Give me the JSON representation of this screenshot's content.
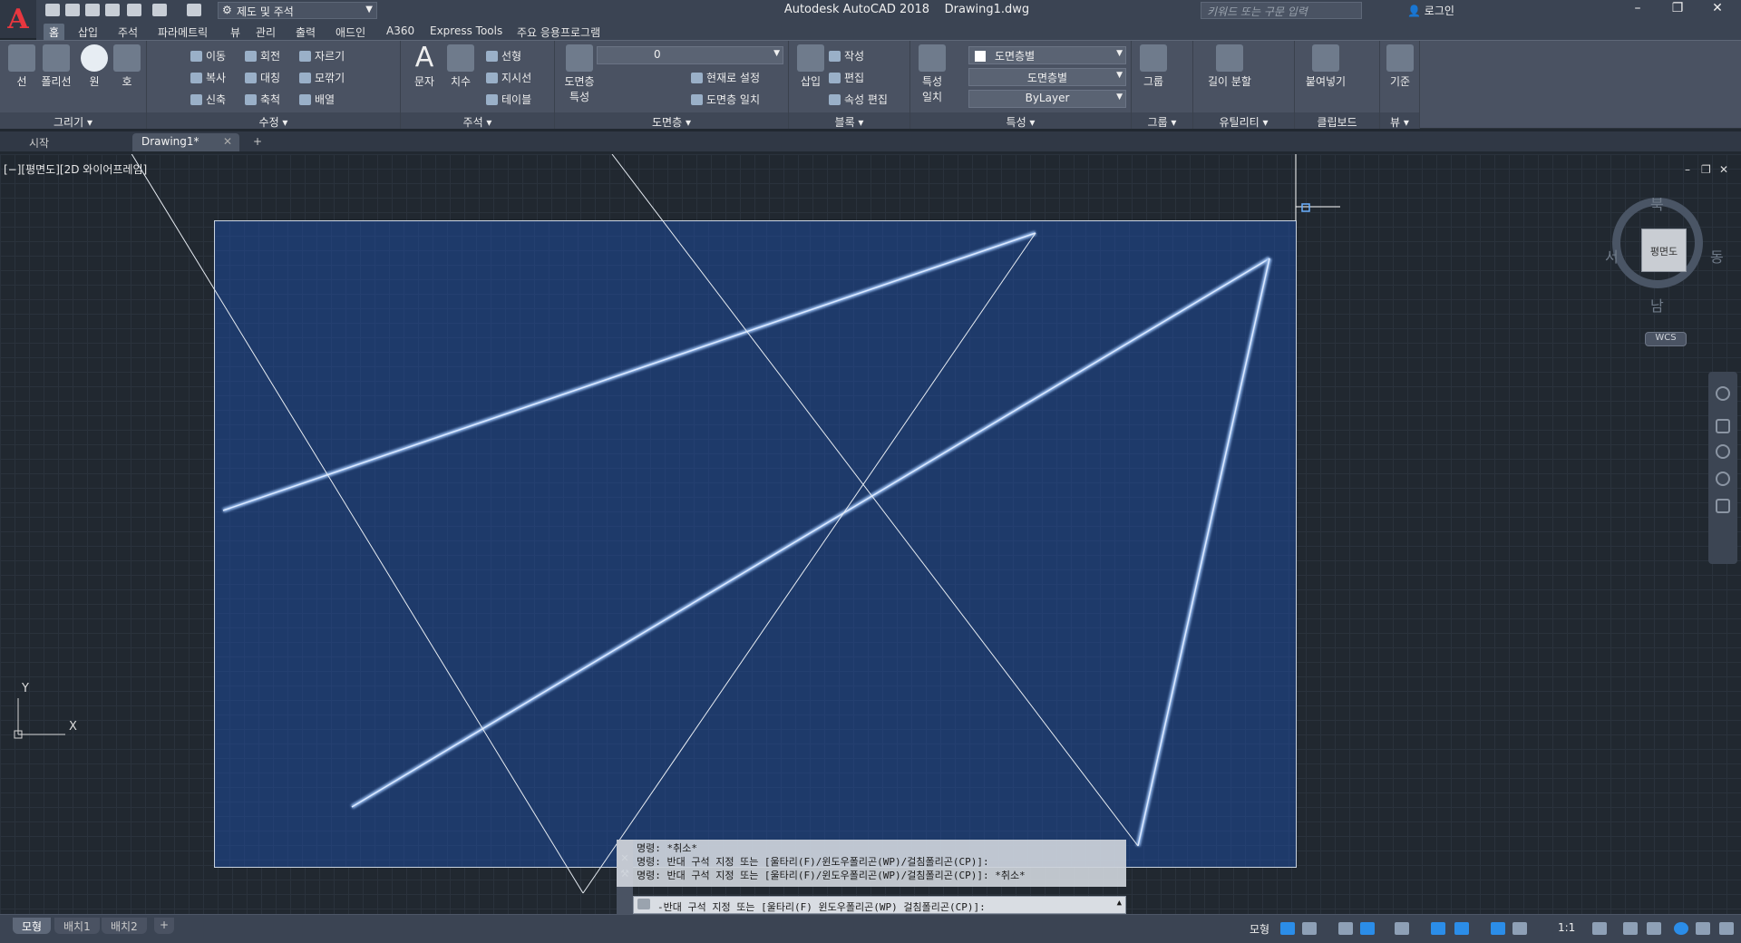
{
  "app": {
    "logo_letter": "A",
    "window_title": "Autodesk AutoCAD 2018    Drawing1.dwg",
    "workspace": "제도 및 주석",
    "search_placeholder": "키워드 또는 구문 입력",
    "login_label": "로그인",
    "minimize": "–",
    "restore": "❐",
    "close": "✕"
  },
  "menu_tabs": [
    "홈",
    "삽입",
    "주석",
    "파라메트릭",
    "뷰",
    "관리",
    "출력",
    "애드인",
    "A360",
    "Express Tools",
    "주요 응용프로그램"
  ],
  "ribbon": {
    "draw": {
      "title": "그리기 ▾",
      "line": "선",
      "polyline": "폴리선",
      "circle": "원",
      "arc": "호"
    },
    "modify": {
      "title": "수정 ▾",
      "move": "이동",
      "rotate": "회전",
      "trim": "자르기",
      "copy": "복사",
      "mirror": "대칭",
      "fillet": "모깎기",
      "stretch": "신축",
      "scale": "축척",
      "array": "배열"
    },
    "annotation": {
      "title": "주석 ▾",
      "text": "문자",
      "dimension": "치수",
      "linear": "선형",
      "leader": "지시선",
      "table": "테이블"
    },
    "layers": {
      "title": "도면층 ▾",
      "layer_props": "도면층\n특성",
      "current_layer": "0",
      "make_current": "현재로 설정",
      "match_layer": "도면층 일치"
    },
    "block": {
      "title": "블록 ▾",
      "insert": "삽입",
      "create": "작성",
      "edit": "편집",
      "edit_attr": "속성 편집"
    },
    "properties": {
      "title": "특성 ▾",
      "match": "특성\n일치",
      "color": "도면층별",
      "linetype": "도면층별",
      "lineweight": "ByLayer"
    },
    "groups": {
      "title": "그룹 ▾",
      "group": "그룹"
    },
    "utilities": {
      "title": "유틸리티 ▾",
      "measure": "길이 분할"
    },
    "clipboard": {
      "title": "클립보드",
      "paste": "붙여넣기"
    },
    "view": {
      "title": "뷰 ▾",
      "base": "기준"
    }
  },
  "doc_tabs": {
    "start": "시작",
    "drawing": "Drawing1*",
    "add": "+"
  },
  "viewport": {
    "label": "[−][평면도][2D 와이어프레임]",
    "viewcube_face": "평면도",
    "north": "북",
    "south": "남",
    "east": "동",
    "west": "서",
    "wcs": "WCS",
    "ucs_x": "X",
    "ucs_y": "Y",
    "ctrl_min": "–",
    "ctrl_restore": "❐",
    "ctrl_close": "✕"
  },
  "command": {
    "history": [
      "명령: *취소*",
      "명령: 반대 구석 지정 또는 [울타리(F)/윈도우폴리곤(WP)/걸침폴리곤(CP)]:",
      "명령: 반대 구석 지정 또는 [울타리(F)/윈도우폴리곤(WP)/걸침폴리곤(CP)]: *취소*"
    ],
    "prompt": "-반대 구석 지정 또는 [울타리(F) 윈도우폴리곤(WP) 걸침폴리곤(CP)]:"
  },
  "layout_tabs": [
    "모형",
    "배치1",
    "배치2",
    "+"
  ],
  "status": {
    "model": "모형",
    "scale": "1:1"
  }
}
